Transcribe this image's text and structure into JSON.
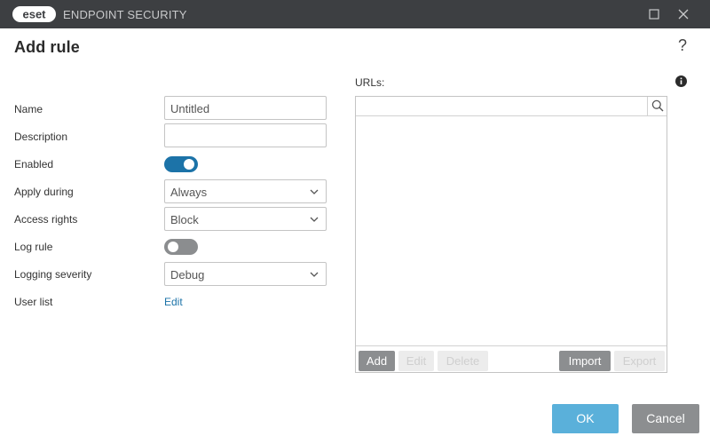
{
  "window": {
    "logo_text": "eset",
    "app_title": "ENDPOINT SECURITY"
  },
  "page": {
    "title": "Add rule",
    "help_icon": "?"
  },
  "form": {
    "name_label": "Name",
    "name_value": "Untitled",
    "description_label": "Description",
    "description_value": "",
    "enabled_label": "Enabled",
    "enabled": true,
    "apply_during_label": "Apply during",
    "apply_during_value": "Always",
    "access_rights_label": "Access rights",
    "access_rights_value": "Block",
    "log_rule_label": "Log rule",
    "log_rule": false,
    "logging_severity_label": "Logging severity",
    "logging_severity_value": "Debug",
    "user_list_label": "User list",
    "user_list_link": "Edit"
  },
  "urls": {
    "label": "URLs:",
    "search_value": "",
    "items": [],
    "buttons": {
      "add": "Add",
      "edit": "Edit",
      "delete": "Delete",
      "import": "Import",
      "export": "Export"
    }
  },
  "dialog": {
    "ok": "OK",
    "cancel": "Cancel"
  },
  "colors": {
    "titlebar": "#3d3f42",
    "accent": "#1c73a8",
    "ok_button": "#5ab0da",
    "neutral_button": "#8c8e90"
  },
  "icons": [
    "eset-logo",
    "maximize-icon",
    "close-icon",
    "help-icon",
    "info-icon",
    "search-icon",
    "chevron-down-icon"
  ]
}
